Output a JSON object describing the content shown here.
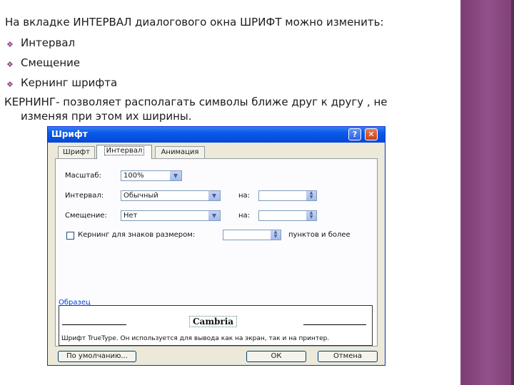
{
  "slide": {
    "heading": "На вкладке ИНТЕРВАЛ диалогового окна ШРИФТ можно изменить:",
    "bullets": [
      "Интервал",
      "Смещение",
      "Кернинг шрифта"
    ],
    "para_line1": "КЕРНИНГ- позволяет располагать символы ближе друг к другу , не",
    "para_line2": "изменяя при этом их ширины."
  },
  "dialog": {
    "title": "Шрифт",
    "help": "?",
    "close": "✕",
    "tabs": [
      "Шрифт",
      "Интервал",
      "Анимация"
    ],
    "scale_label": "Масштаб:",
    "scale_value": "100%",
    "spacing_label": "Интервал:",
    "spacing_value": "Обычный",
    "on_label_1": "на:",
    "offset_label": "Смещение:",
    "offset_value": "Нет",
    "on_label_2": "на:",
    "kerning_label": "Кернинг для знаков размером:",
    "kerning_suffix": "пунктов и более",
    "preview_label": "Образец",
    "preview_text": "Cambria",
    "preview_note": "Шрифт TrueType. Он используется для вывода как на экран, так и на принтер.",
    "default_button": "По умолчанию...",
    "ok_button": "ОК",
    "cancel_button": "Отмена"
  },
  "icons": {
    "bullet": "diamond-bullet-icon",
    "dropdown": "chevron-down-icon",
    "spinner": "spinner-icon"
  },
  "colors": {
    "titlebar": "#0a5ce9",
    "stripe": "#8a4681",
    "bullet": "#8a3f82"
  }
}
